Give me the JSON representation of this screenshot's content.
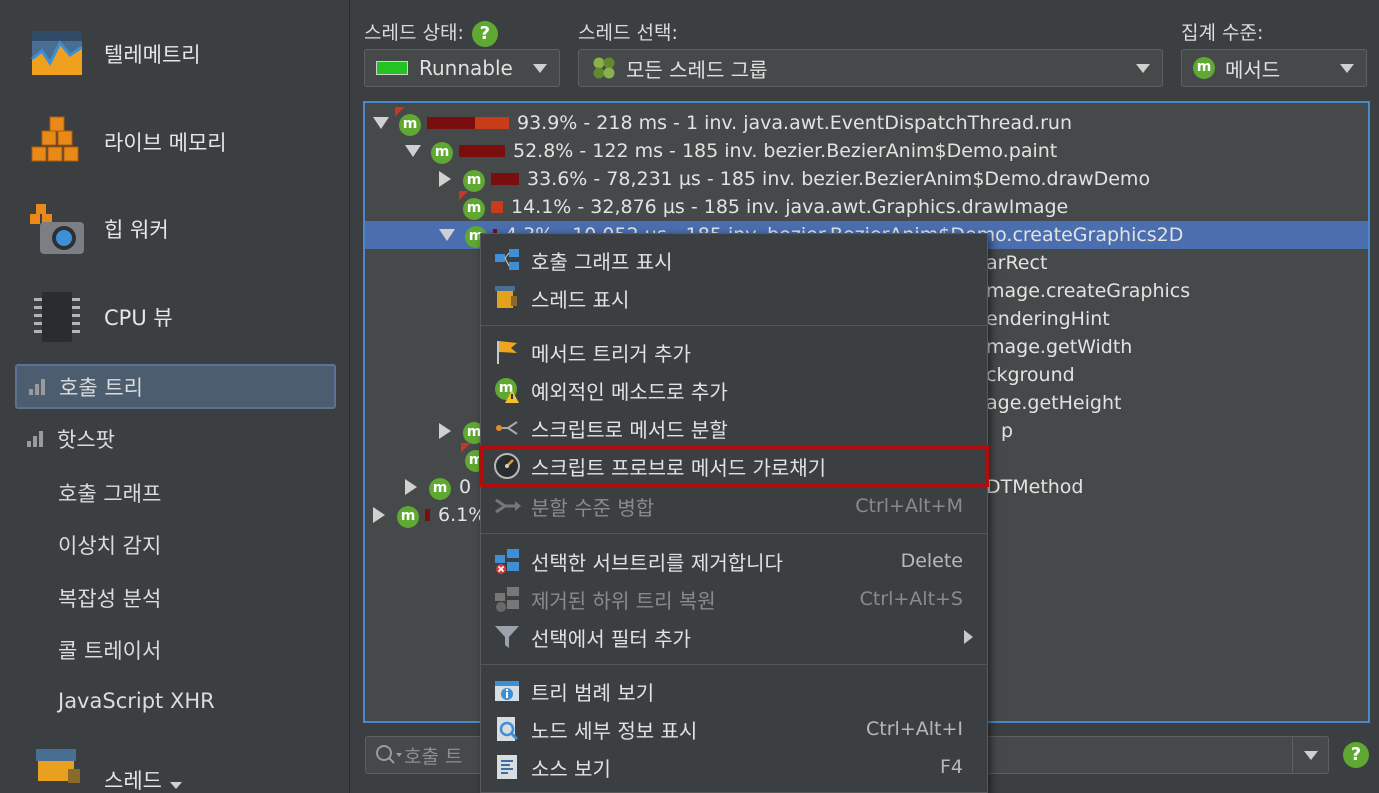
{
  "sidebar": {
    "big_items": [
      {
        "label": "텔레메트리",
        "icon": "telemetry-icon"
      },
      {
        "label": "라이브 메모리",
        "icon": "live-memory-icon"
      },
      {
        "label": "힙 워커",
        "icon": "heap-walker-icon"
      },
      {
        "label": "CPU 뷰",
        "icon": "cpu-view-icon"
      }
    ],
    "sub_items": [
      {
        "label": "호출 트리",
        "active": true
      },
      {
        "label": "핫스팟",
        "active": false
      }
    ],
    "plain_items": [
      "호출 그래프",
      "이상치 감지",
      "복잡성 분석",
      "콜 트레이서",
      "JavaScript XHR"
    ],
    "bottom_item": "스레드"
  },
  "toolbar": {
    "thread_status_label": "스레드 상태:",
    "thread_status_value": "Runnable",
    "thread_status_color": "#22c322",
    "thread_select_label": "스레드 선택:",
    "thread_select_value": "모든 스레드 그룹",
    "aggregation_label": "집계 수준:",
    "aggregation_value": "메서드",
    "help_glyph": "?"
  },
  "tree": {
    "node_badge": "m",
    "rows": [
      {
        "text": "93.9% - 218 ms - 1 inv. java.awt.EventDispatchThread.run",
        "pct": 0.939
      },
      {
        "text": "52.8% - 122 ms - 185 inv. bezier.BezierAnim$Demo.paint",
        "pct": 0.528
      },
      {
        "text": "33.6% - 78,231 µs - 185 inv. bezier.BezierAnim$Demo.drawDemo",
        "pct": 0.336
      },
      {
        "text": "14.1% - 32,876 µs - 185 inv. java.awt.Graphics.drawImage",
        "pct": 0.141
      },
      {
        "text": "4.3% - 10,052 µs - 185 inv. bezier.BezierAnim$Demo.createGraphics2D",
        "pct": 0.043
      },
      {
        "text": "arRect"
      },
      {
        "text": "mage.createGraphics"
      },
      {
        "text": "enderingHint"
      },
      {
        "text": "mage.getWidth"
      },
      {
        "text": "ckground"
      },
      {
        "text": "age.getHeight"
      },
      {
        "text": "p"
      },
      {
        "text": ""
      },
      {
        "text": "0",
        "right": "DTMethod"
      },
      {
        "text": "6.1%",
        "pct": 0.061
      }
    ]
  },
  "search": {
    "placeholder": "호출 트"
  },
  "context_menu": {
    "items": [
      {
        "label": "호출 그래프 표시",
        "shortcut": "",
        "icon": "call-graph-icon"
      },
      {
        "label": "스레드 표시",
        "shortcut": "",
        "icon": "thread-icon"
      },
      {
        "label": "메서드 트리거 추가",
        "shortcut": "",
        "icon": "flag-icon"
      },
      {
        "label": "예외적인 메소드로 추가",
        "shortcut": "",
        "icon": "exceptional-method-icon"
      },
      {
        "label": "스크립트로 메서드 분할",
        "shortcut": "",
        "icon": "split-icon"
      },
      {
        "label": "스크립트 프로브로 메서드 가로채기",
        "shortcut": "",
        "icon": "probe-gauge-icon"
      },
      {
        "label": "분할 수준 병합",
        "shortcut": "Ctrl+Alt+M",
        "icon": "merge-icon",
        "disabled": true
      },
      {
        "label": "선택한 서브트리를 제거합니다",
        "shortcut": "Delete",
        "icon": "remove-subtree-icon"
      },
      {
        "label": "제거된 하위 트리 복원",
        "shortcut": "Ctrl+Alt+S",
        "icon": "restore-subtree-icon",
        "disabled": true
      },
      {
        "label": "선택에서 필터 추가",
        "shortcut": "",
        "icon": "filter-icon",
        "submenu": true
      },
      {
        "label": "트리 범례 보기",
        "shortcut": "",
        "icon": "info-icon"
      },
      {
        "label": "노드 세부 정보 표시",
        "shortcut": "Ctrl+Alt+I",
        "icon": "node-details-icon"
      },
      {
        "label": "소스 보기",
        "shortcut": "F4",
        "icon": "source-icon"
      }
    ]
  }
}
